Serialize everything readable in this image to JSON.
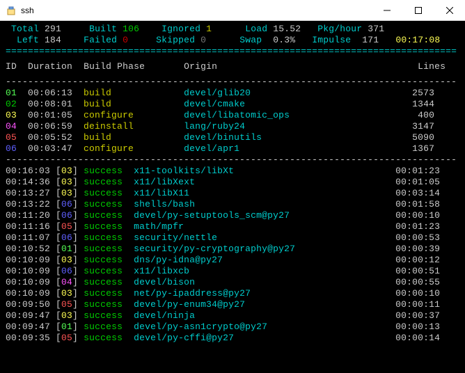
{
  "window": {
    "title": "ssh"
  },
  "stats": {
    "total_label": "Total",
    "total": "291",
    "built_label": "Built",
    "built": "106",
    "ignored_label": "Ignored",
    "ignored": "1",
    "load_label": "Load",
    "load": "15.52",
    "pkghour_label": "Pkg/hour",
    "pkghour": "371",
    "left_label": "Left",
    "left": "184",
    "failed_label": "Failed",
    "failed": "0",
    "skipped_label": "Skipped",
    "skipped": "0",
    "swap_label": "Swap",
    "swap": "0.3%",
    "impulse_label": "Impulse",
    "impulse": "171",
    "elapsed": "00:17:08"
  },
  "columns": {
    "id": "ID",
    "duration": "Duration",
    "phase": "Build Phase",
    "origin": "Origin",
    "lines": "Lines"
  },
  "builders": [
    {
      "id": "01",
      "dur": "00:06:13",
      "phase": "build",
      "origin": "devel/glib20",
      "lines": "2573",
      "idc": "brgreen",
      "pc": "yellow"
    },
    {
      "id": "02",
      "dur": "00:08:01",
      "phase": "build",
      "origin": "devel/cmake",
      "lines": "1344",
      "idc": "green",
      "pc": "yellow"
    },
    {
      "id": "03",
      "dur": "00:01:05",
      "phase": "configure",
      "origin": "devel/libatomic_ops",
      "lines": "400",
      "idc": "bryellow",
      "pc": "yellow"
    },
    {
      "id": "04",
      "dur": "00:06:59",
      "phase": "deinstall",
      "origin": "lang/ruby24",
      "lines": "3147",
      "idc": "brmag",
      "pc": "yellow"
    },
    {
      "id": "05",
      "dur": "00:05:52",
      "phase": "build",
      "origin": "devel/binutils",
      "lines": "5090",
      "idc": "brred",
      "pc": "yellow"
    },
    {
      "id": "06",
      "dur": "00:03:47",
      "phase": "configure",
      "origin": "devel/apr1",
      "lines": "1367",
      "idc": "blue",
      "pc": "yellow"
    }
  ],
  "log": [
    {
      "t": "00:16:03",
      "bid": "03",
      "bidc": "bryellow",
      "status": "success",
      "origin": "x11-toolkits/libXt",
      "dur": "00:01:23"
    },
    {
      "t": "00:14:36",
      "bid": "03",
      "bidc": "bryellow",
      "status": "success",
      "origin": "x11/libXext",
      "dur": "00:01:05"
    },
    {
      "t": "00:13:27",
      "bid": "03",
      "bidc": "bryellow",
      "status": "success",
      "origin": "x11/libX11",
      "dur": "00:03:14"
    },
    {
      "t": "00:13:22",
      "bid": "06",
      "bidc": "blue",
      "status": "success",
      "origin": "shells/bash",
      "dur": "00:01:58"
    },
    {
      "t": "00:11:20",
      "bid": "06",
      "bidc": "blue",
      "status": "success",
      "origin": "devel/py-setuptools_scm@py27",
      "dur": "00:00:10"
    },
    {
      "t": "00:11:16",
      "bid": "05",
      "bidc": "brred",
      "status": "success",
      "origin": "math/mpfr",
      "dur": "00:01:23"
    },
    {
      "t": "00:11:07",
      "bid": "06",
      "bidc": "blue",
      "status": "success",
      "origin": "security/nettle",
      "dur": "00:00:53"
    },
    {
      "t": "00:10:52",
      "bid": "01",
      "bidc": "brgreen",
      "status": "success",
      "origin": "security/py-cryptography@py27",
      "dur": "00:00:39"
    },
    {
      "t": "00:10:09",
      "bid": "03",
      "bidc": "bryellow",
      "status": "success",
      "origin": "dns/py-idna@py27",
      "dur": "00:00:12"
    },
    {
      "t": "00:10:09",
      "bid": "06",
      "bidc": "blue",
      "status": "success",
      "origin": "x11/libxcb",
      "dur": "00:00:51"
    },
    {
      "t": "00:10:09",
      "bid": "04",
      "bidc": "brmag",
      "status": "success",
      "origin": "devel/bison",
      "dur": "00:00:55"
    },
    {
      "t": "00:10:09",
      "bid": "03",
      "bidc": "bryellow",
      "status": "success",
      "origin": "net/py-ipaddress@py27",
      "dur": "00:00:10"
    },
    {
      "t": "00:09:50",
      "bid": "05",
      "bidc": "brred",
      "status": "success",
      "origin": "devel/py-enum34@py27",
      "dur": "00:00:11"
    },
    {
      "t": "00:09:47",
      "bid": "03",
      "bidc": "bryellow",
      "status": "success",
      "origin": "devel/ninja",
      "dur": "00:00:37"
    },
    {
      "t": "00:09:47",
      "bid": "01",
      "bidc": "brgreen",
      "status": "success",
      "origin": "devel/py-asn1crypto@py27",
      "dur": "00:00:13"
    },
    {
      "t": "00:09:35",
      "bid": "05",
      "bidc": "brred",
      "status": "success",
      "origin": "devel/py-cffi@py27",
      "dur": "00:00:14"
    }
  ],
  "divider": "=================================================================================",
  "dashline": "---------------------------------------------------------------------------------"
}
